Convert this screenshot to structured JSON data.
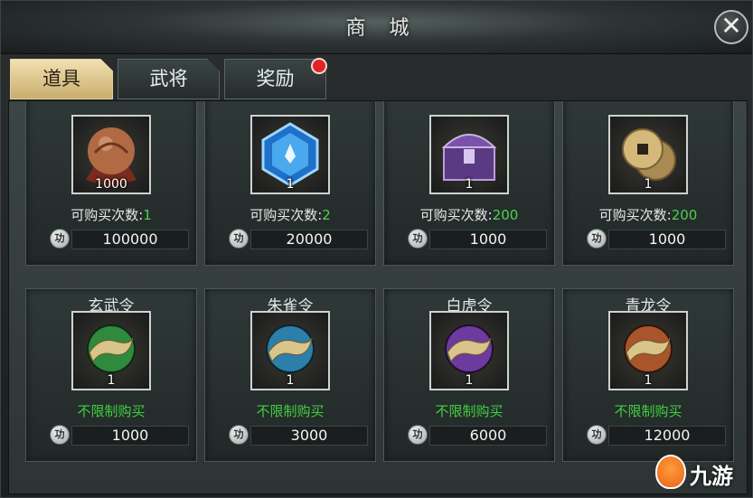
{
  "window": {
    "title": "商城",
    "close_symbol": "✕"
  },
  "tabs": [
    {
      "label": "道具",
      "active": true
    },
    {
      "label": "武将",
      "active": false
    },
    {
      "label": "奖励",
      "active": false,
      "has_badge": true
    }
  ],
  "currency_icon_char": "功",
  "items_row1": [
    {
      "name": "",
      "qty": "1000",
      "limit_label": "可购买次数:",
      "limit_value": "1",
      "price": "100000",
      "icon": "dragon-ball-icon"
    },
    {
      "name": "",
      "qty": "1",
      "limit_label": "可购买次数:",
      "limit_value": "2",
      "price": "20000",
      "icon": "blue-crystal-icon"
    },
    {
      "name": "",
      "qty": "1",
      "limit_label": "可购买次数:",
      "limit_value": "200",
      "price": "1000",
      "icon": "purple-chest-icon"
    },
    {
      "name": "",
      "qty": "1",
      "limit_label": "可购买次数:",
      "limit_value": "200",
      "price": "1000",
      "icon": "copper-coins-icon"
    }
  ],
  "items_row2": [
    {
      "name": "玄武令",
      "qty": "1",
      "limit_text": "不限制购买",
      "price": "1000",
      "icon": "green-token-icon",
      "color": "#2f8a3e"
    },
    {
      "name": "朱雀令",
      "qty": "1",
      "limit_text": "不限制购买",
      "price": "3000",
      "icon": "blue-token-icon",
      "color": "#2c7fa8"
    },
    {
      "name": "白虎令",
      "qty": "1",
      "limit_text": "不限制购买",
      "price": "6000",
      "icon": "purple-token-icon",
      "color": "#6d3aa0"
    },
    {
      "name": "青龙令",
      "qty": "1",
      "limit_text": "不限制购买",
      "price": "12000",
      "icon": "orange-token-icon",
      "color": "#a8552c"
    }
  ],
  "watermark": {
    "text": "九游"
  }
}
